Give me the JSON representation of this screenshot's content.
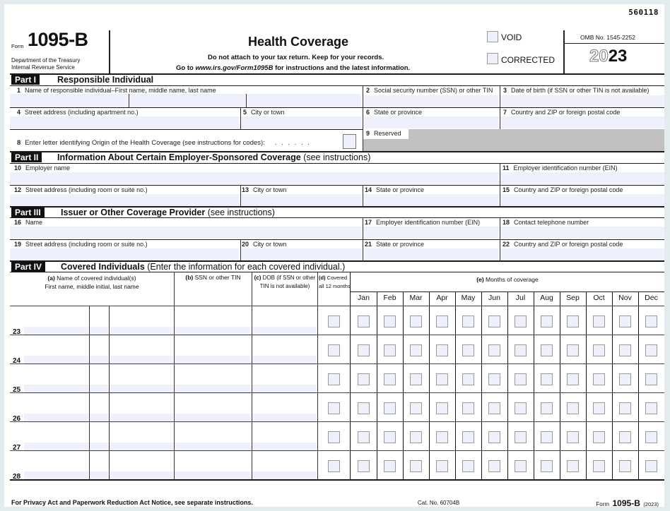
{
  "doc_number": "560118",
  "header": {
    "form_prefix": "Form",
    "form_number": "1095-B",
    "dept_line1": "Department of the Treasury",
    "dept_line2": "Internal Revenue Service",
    "title": "Health Coverage",
    "subtitle1": "Do not attach to your tax return. Keep for your records.",
    "subtitle2_pre": "Go to ",
    "subtitle2_link": "www.irs.gov/Form1095B",
    "subtitle2_post": " for instructions and the latest information.",
    "void_label": "VOID",
    "corrected_label": "CORRECTED",
    "omb": "OMB No. 1545-2252",
    "year_outline": "20",
    "year_bold": "23"
  },
  "part1": {
    "tag": "Part I",
    "title": "Responsible Individual",
    "f1": {
      "num": "1",
      "label": "Name of responsible individual–First name, middle name, last name"
    },
    "f2": {
      "num": "2",
      "label": "Social security number (SSN) or other TIN"
    },
    "f3": {
      "num": "3",
      "label": "Date of birth (if SSN or other TIN is not available)"
    },
    "f4": {
      "num": "4",
      "label": "Street address (including apartment no.)"
    },
    "f5": {
      "num": "5",
      "label": "City or town"
    },
    "f6": {
      "num": "6",
      "label": "State or province"
    },
    "f7": {
      "num": "7",
      "label": "Country and ZIP or foreign postal code"
    },
    "f8": {
      "num": "8",
      "label": "Enter letter identifying Origin of the Health Coverage (see instructions for codes):",
      "dots": ". . . . . ."
    },
    "f9": {
      "num": "9",
      "label": "Reserved"
    }
  },
  "part2": {
    "tag": "Part II",
    "title": "Information About Certain Employer-Sponsored Coverage",
    "title_note": " (see instructions)",
    "f10": {
      "num": "10",
      "label": "Employer name"
    },
    "f11": {
      "num": "11",
      "label": "Employer identification number (EIN)"
    },
    "f12": {
      "num": "12",
      "label": "Street address (including room or suite no.)"
    },
    "f13": {
      "num": "13",
      "label": "City or town"
    },
    "f14": {
      "num": "14",
      "label": "State or province"
    },
    "f15": {
      "num": "15",
      "label": "Country and ZIP or foreign postal code"
    }
  },
  "part3": {
    "tag": "Part III",
    "title": "Issuer or Other Coverage Provider",
    "title_note": " (see instructions)",
    "f16": {
      "num": "16",
      "label": "Name"
    },
    "f17": {
      "num": "17",
      "label": "Employer identification number (EIN)"
    },
    "f18": {
      "num": "18",
      "label": "Contact telephone number"
    },
    "f19": {
      "num": "19",
      "label": "Street address (including room or suite no.)"
    },
    "f20": {
      "num": "20",
      "label": "City or town"
    },
    "f21": {
      "num": "21",
      "label": "State or province"
    },
    "f22": {
      "num": "22",
      "label": "Country and ZIP or foreign postal code"
    }
  },
  "part4": {
    "tag": "Part IV",
    "title": "Covered Individuals",
    "title_note": " (Enter the information for each covered individual.)",
    "col_a_bold": "(a)",
    "col_a_line1": " Name of covered individual(s)",
    "col_a_line2": "First name, middle initial, last name",
    "col_b_bold": "(b)",
    "col_b": " SSN or other TIN",
    "col_c_bold": "(c)",
    "col_c_line1": " DOB (if SSN or other",
    "col_c_line2": "TIN is not available)",
    "col_d_bold": "(d)",
    "col_d_line1": " Covered",
    "col_d_line2": "all 12 months",
    "col_e_bold": "(e)",
    "col_e": " Months of coverage",
    "months": [
      "Jan",
      "Feb",
      "Mar",
      "Apr",
      "May",
      "Jun",
      "Jul",
      "Aug",
      "Sep",
      "Oct",
      "Nov",
      "Dec"
    ],
    "rows": [
      "23",
      "24",
      "25",
      "26",
      "27",
      "28"
    ]
  },
  "footer": {
    "notice": "For Privacy Act and Paperwork Reduction Act Notice, see separate instructions.",
    "cat": "Cat. No. 60704B",
    "form_prefix": "Form",
    "form_number": "1095-B",
    "year": "(2023)"
  }
}
